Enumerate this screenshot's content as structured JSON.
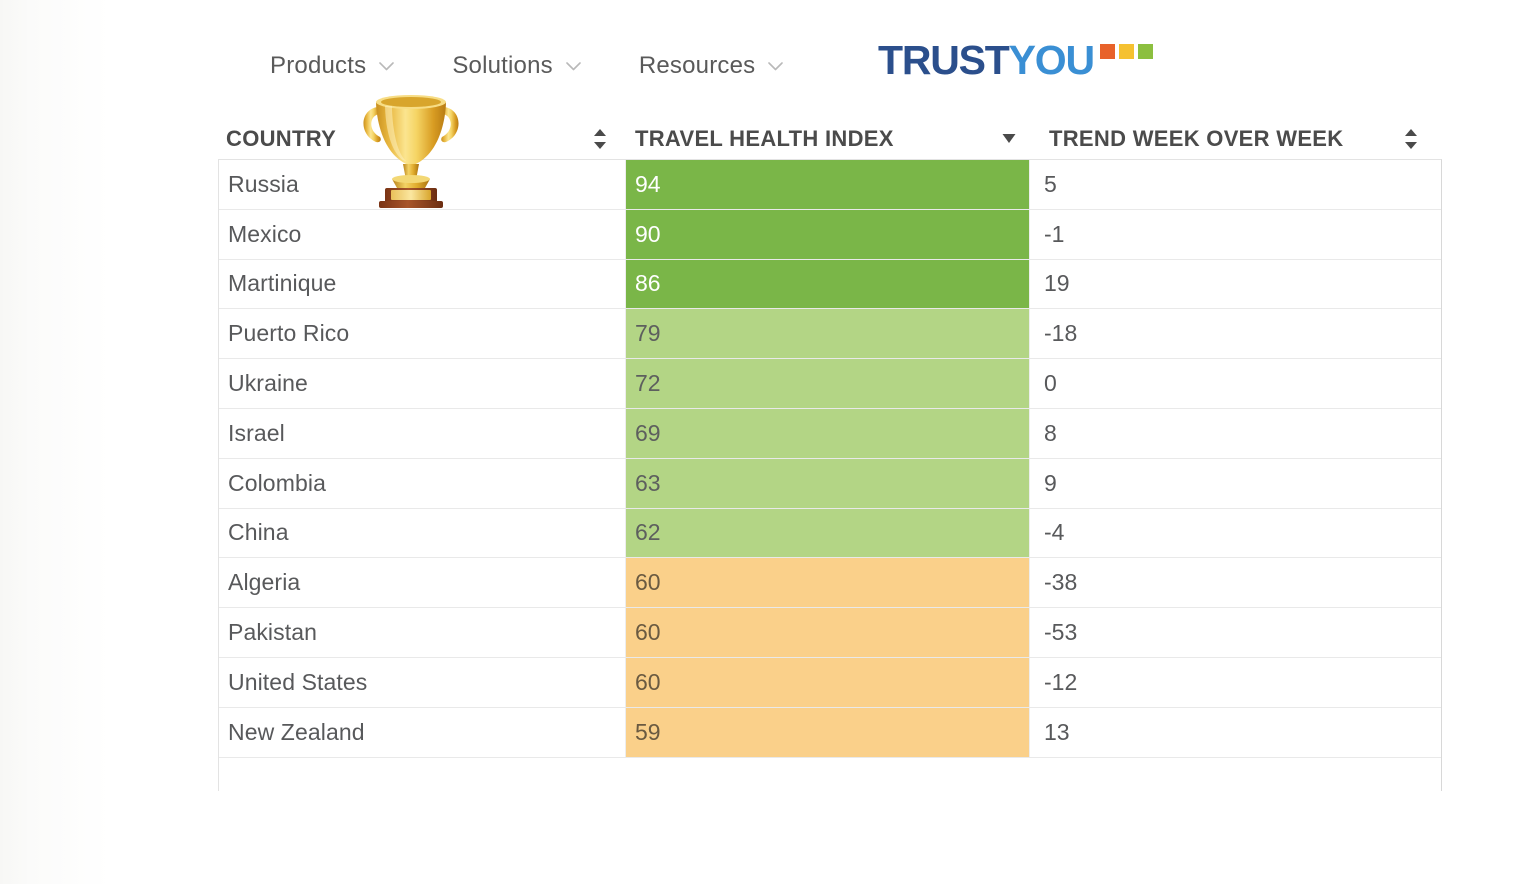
{
  "nav": {
    "items": [
      {
        "label": "Products",
        "icon": "chevron-down-icon"
      },
      {
        "label": "Solutions",
        "icon": "chevron-down-icon"
      },
      {
        "label": "Resources",
        "icon": "chevron-down-icon"
      }
    ]
  },
  "logo": {
    "part1": "TRUST",
    "part2": "YOU",
    "part1_color": "#2b4f8c",
    "part2_color": "#3a8fd4",
    "squares": [
      "#e8622a",
      "#f5c131",
      "#8cbf3f"
    ]
  },
  "decoration": {
    "trophy_icon": "trophy-icon"
  },
  "table": {
    "columns": [
      {
        "label": "COUNTRY",
        "sort_icon": "sort-both-icon",
        "sort_state": "none"
      },
      {
        "label": "TRAVEL HEALTH INDEX",
        "sort_icon": "sort-desc-icon",
        "sort_state": "descending"
      },
      {
        "label": "TREND WEEK OVER WEEK",
        "sort_icon": "sort-both-icon",
        "sort_state": "none"
      }
    ],
    "rows": [
      {
        "country": "Russia",
        "index": "94",
        "trend": "5",
        "tier": "score-high"
      },
      {
        "country": "Mexico",
        "index": "90",
        "trend": "-1",
        "tier": "score-high"
      },
      {
        "country": "Martinique",
        "index": "86",
        "trend": "19",
        "tier": "score-high"
      },
      {
        "country": "Puerto Rico",
        "index": "79",
        "trend": "-18",
        "tier": "score-mid"
      },
      {
        "country": "Ukraine",
        "index": "72",
        "trend": "0",
        "tier": "score-mid"
      },
      {
        "country": "Israel",
        "index": "69",
        "trend": "8",
        "tier": "score-mid"
      },
      {
        "country": "Colombia",
        "index": "63",
        "trend": "9",
        "tier": "score-mid"
      },
      {
        "country": "China",
        "index": "62",
        "trend": "-4",
        "tier": "score-mid"
      },
      {
        "country": "Algeria",
        "index": "60",
        "trend": "-38",
        "tier": "score-low"
      },
      {
        "country": "Pakistan",
        "index": "60",
        "trend": "-53",
        "tier": "score-low"
      },
      {
        "country": "United States",
        "index": "60",
        "trend": "-12",
        "tier": "score-low"
      },
      {
        "country": "New Zealand",
        "index": "59",
        "trend": "13",
        "tier": "score-low"
      }
    ]
  },
  "colors": {
    "tier_high": "#7ab648",
    "tier_mid": "#b3d585",
    "tier_low": "#fad08a",
    "header_text": "#4b4b4b",
    "body_text": "#58595b"
  }
}
